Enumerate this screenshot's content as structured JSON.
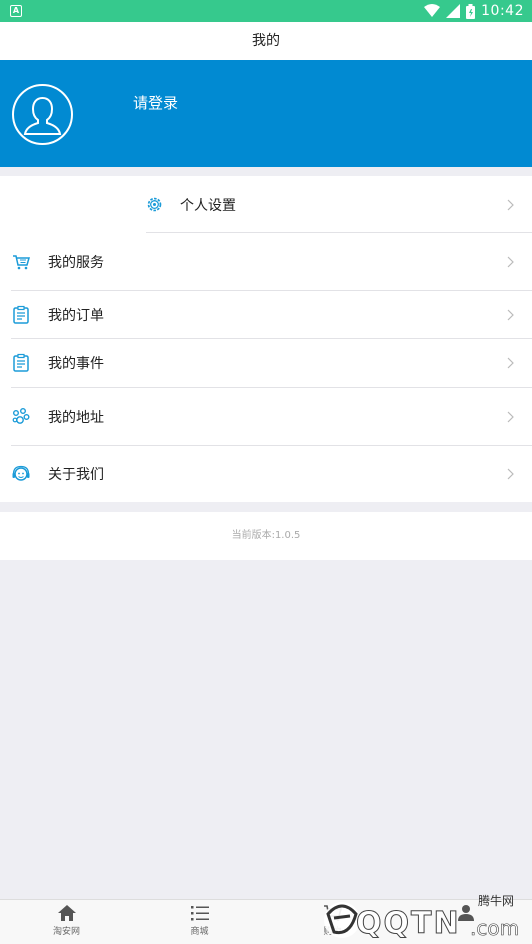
{
  "status_bar": {
    "time": "10:42",
    "notification_icon": "android-icon",
    "wifi_icon": "wifi-icon",
    "signal_icon": "signal-icon",
    "battery_icon": "battery-icon"
  },
  "title": "我的",
  "profile": {
    "login_prompt": "请登录",
    "avatar_icon": "user-avatar-icon"
  },
  "menu": {
    "settings": {
      "label": "个人设置",
      "icon": "gear-icon"
    },
    "items": [
      {
        "label": "我的服务",
        "icon": "cart-icon"
      },
      {
        "label": "我的订单",
        "icon": "clipboard-icon"
      },
      {
        "label": "我的事件",
        "icon": "clipboard-icon"
      },
      {
        "label": "我的地址",
        "icon": "location-icon"
      },
      {
        "label": "关于我们",
        "icon": "support-icon"
      }
    ]
  },
  "version_text": "当前版本:1.0.5",
  "tabs": [
    {
      "label": "淘安网",
      "icon": "home-icon"
    },
    {
      "label": "商城",
      "icon": "list-icon"
    },
    {
      "label": "购物",
      "icon": "cart-icon"
    },
    {
      "label": "",
      "icon": "user-icon"
    }
  ],
  "watermark": {
    "cn": "腾牛网",
    "en": "QQTN",
    "suffix": ".com"
  },
  "colors": {
    "status_bar": "#36c98d",
    "profile_bg": "#018ad2",
    "icon_accent": "#1b9bd8"
  }
}
